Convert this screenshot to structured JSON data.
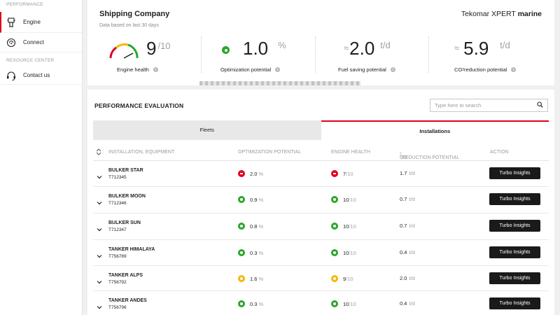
{
  "sidebar": {
    "section_performance": "PERFORMANCE",
    "items": [
      {
        "label": "Engine",
        "icon": "engine-icon"
      },
      {
        "label": "Connect",
        "icon": "connect-icon"
      }
    ],
    "section_resource": "RESOURCE CENTER",
    "contact": {
      "label": "Contact us",
      "icon": "headset-icon"
    }
  },
  "summary": {
    "company": "Shipping Company",
    "note": "Data based on last 30 days",
    "brand_regular": "Tekomar XPERT",
    "brand_bold": "marine",
    "kpis": {
      "engine_health": {
        "value": "9",
        "unit": "/10",
        "label": "Engine health"
      },
      "optimization": {
        "value": "1.0",
        "unit": "%",
        "label": "Optimization potential"
      },
      "fuel": {
        "prefix": "≈",
        "value": "2.0",
        "unit": "t/d",
        "label": "Fuel saving potential"
      },
      "co2": {
        "prefix": "≈",
        "value": "5.9",
        "unit": "t/d",
        "label_pre": "CO",
        "label_sub": "2",
        "label_post": " reduction potential"
      }
    }
  },
  "panel": {
    "title": "PERFORMANCE EVALUATION",
    "search_placeholder": "Type here to search",
    "tabs": {
      "fleets": "Fleets",
      "installations": "Installations"
    },
    "columns": {
      "installation": "INSTALLATION, EQUIPMENT",
      "optimization": "OPTIMIZATION POTENTIAL",
      "engine_health": "ENGINE HEALTH",
      "co2_pre": "CO",
      "co2_sub": "2",
      "co2_post": " REDUCTION POTENTIAL",
      "action": "ACTION"
    },
    "unit_pct": "%",
    "unit_td": "t/d",
    "health_suffix": "/10",
    "action_label": "Turbo Insights",
    "rows": [
      {
        "name": "BULKER STAR",
        "serial": "T712345",
        "opt": "2.0",
        "opt_status": "red",
        "health": "7",
        "health_status": "red",
        "co2": "1.7"
      },
      {
        "name": "BULKER MOON",
        "serial": "T712346",
        "opt": "0.9",
        "opt_status": "green",
        "health": "10",
        "health_status": "green",
        "co2": "0.7"
      },
      {
        "name": "BULKER SUN",
        "serial": "T712347",
        "opt": "0.8",
        "opt_status": "green",
        "health": "10",
        "health_status": "green",
        "co2": "0.7"
      },
      {
        "name": "TANKER HIMALAYA",
        "serial": "T756789",
        "opt": "0.3",
        "opt_status": "green",
        "health": "10",
        "health_status": "green",
        "co2": "0.4"
      },
      {
        "name": "TANKER ALPS",
        "serial": "T756792",
        "opt": "1.6",
        "opt_status": "yellow",
        "health": "9",
        "health_status": "yellow",
        "co2": "2.0"
      },
      {
        "name": "TANKER ANDES",
        "serial": "T756796",
        "opt": "0.3",
        "opt_status": "green",
        "health": "10",
        "health_status": "green",
        "co2": "0.4"
      }
    ]
  },
  "colors": {
    "accent": "#e0001b",
    "green": "#2aa62a",
    "yellow": "#f5b800",
    "button": "#1a1a1a"
  }
}
